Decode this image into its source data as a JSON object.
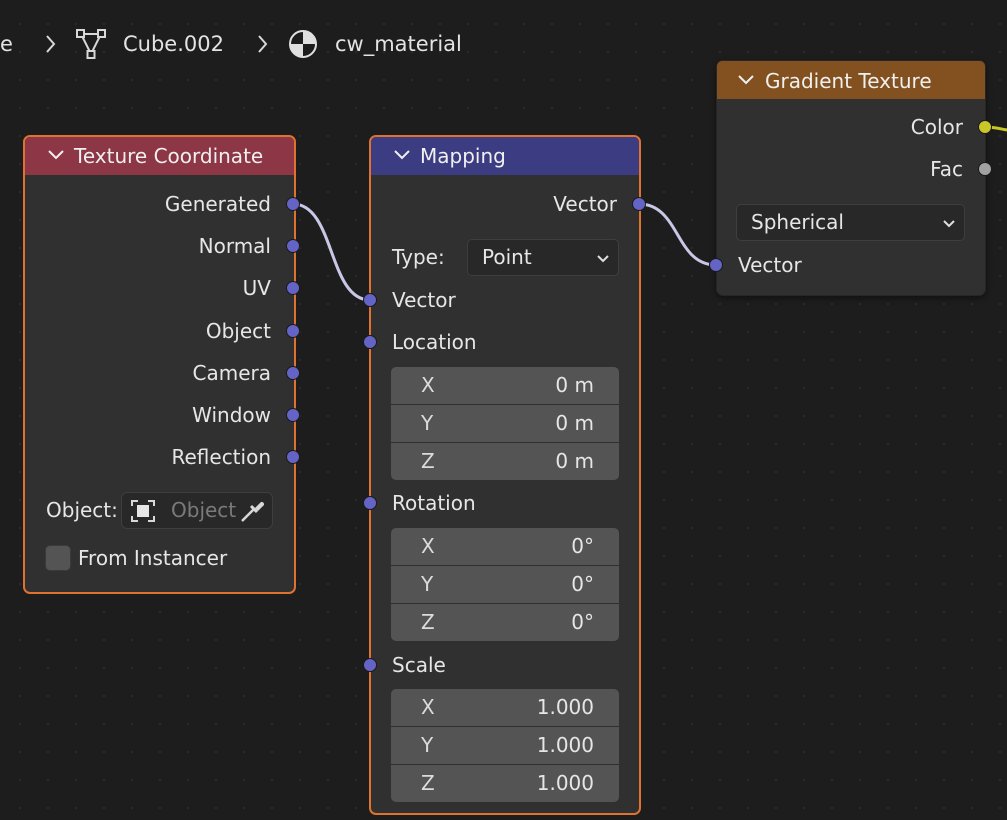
{
  "breadcrumb": {
    "partial": "e",
    "object": "Cube.002",
    "material": "cw_material"
  },
  "colors": {
    "selected_border": "#e0722f",
    "vector_socket": "#6464c6",
    "color_socket": "#c7c729",
    "float_socket": "#a1a1a1",
    "link": "#c8c8e6"
  },
  "texture_coordinate": {
    "title": "Texture Coordinate",
    "header_color": "#8d3646",
    "outputs": [
      "Generated",
      "Normal",
      "UV",
      "Object",
      "Camera",
      "Window",
      "Reflection"
    ],
    "object_label": "Object:",
    "object_placeholder": "Object",
    "from_instancer": "From Instancer"
  },
  "mapping": {
    "title": "Mapping",
    "header_color": "#3c3c82",
    "output": "Vector",
    "type_label": "Type:",
    "type_value": "Point",
    "vector_input": "Vector",
    "location": {
      "label": "Location",
      "x": "0 m",
      "y": "0 m",
      "z": "0 m"
    },
    "rotation": {
      "label": "Rotation",
      "x": "0°",
      "y": "0°",
      "z": "0°"
    },
    "scale": {
      "label": "Scale",
      "x": "1.000",
      "y": "1.000",
      "z": "1.000"
    },
    "axis": [
      "X",
      "Y",
      "Z"
    ]
  },
  "gradient_texture": {
    "title": "Gradient Texture",
    "header_color": "#82511f",
    "outputs": [
      "Color",
      "Fac"
    ],
    "gradient_type": "Spherical",
    "vector_input": "Vector"
  },
  "icons": [
    "chevron-right-icon",
    "mesh-object-icon",
    "material-icon",
    "collapse-chevron-icon",
    "eyedropper-icon",
    "object-box-icon",
    "dropdown-chevron-icon"
  ]
}
